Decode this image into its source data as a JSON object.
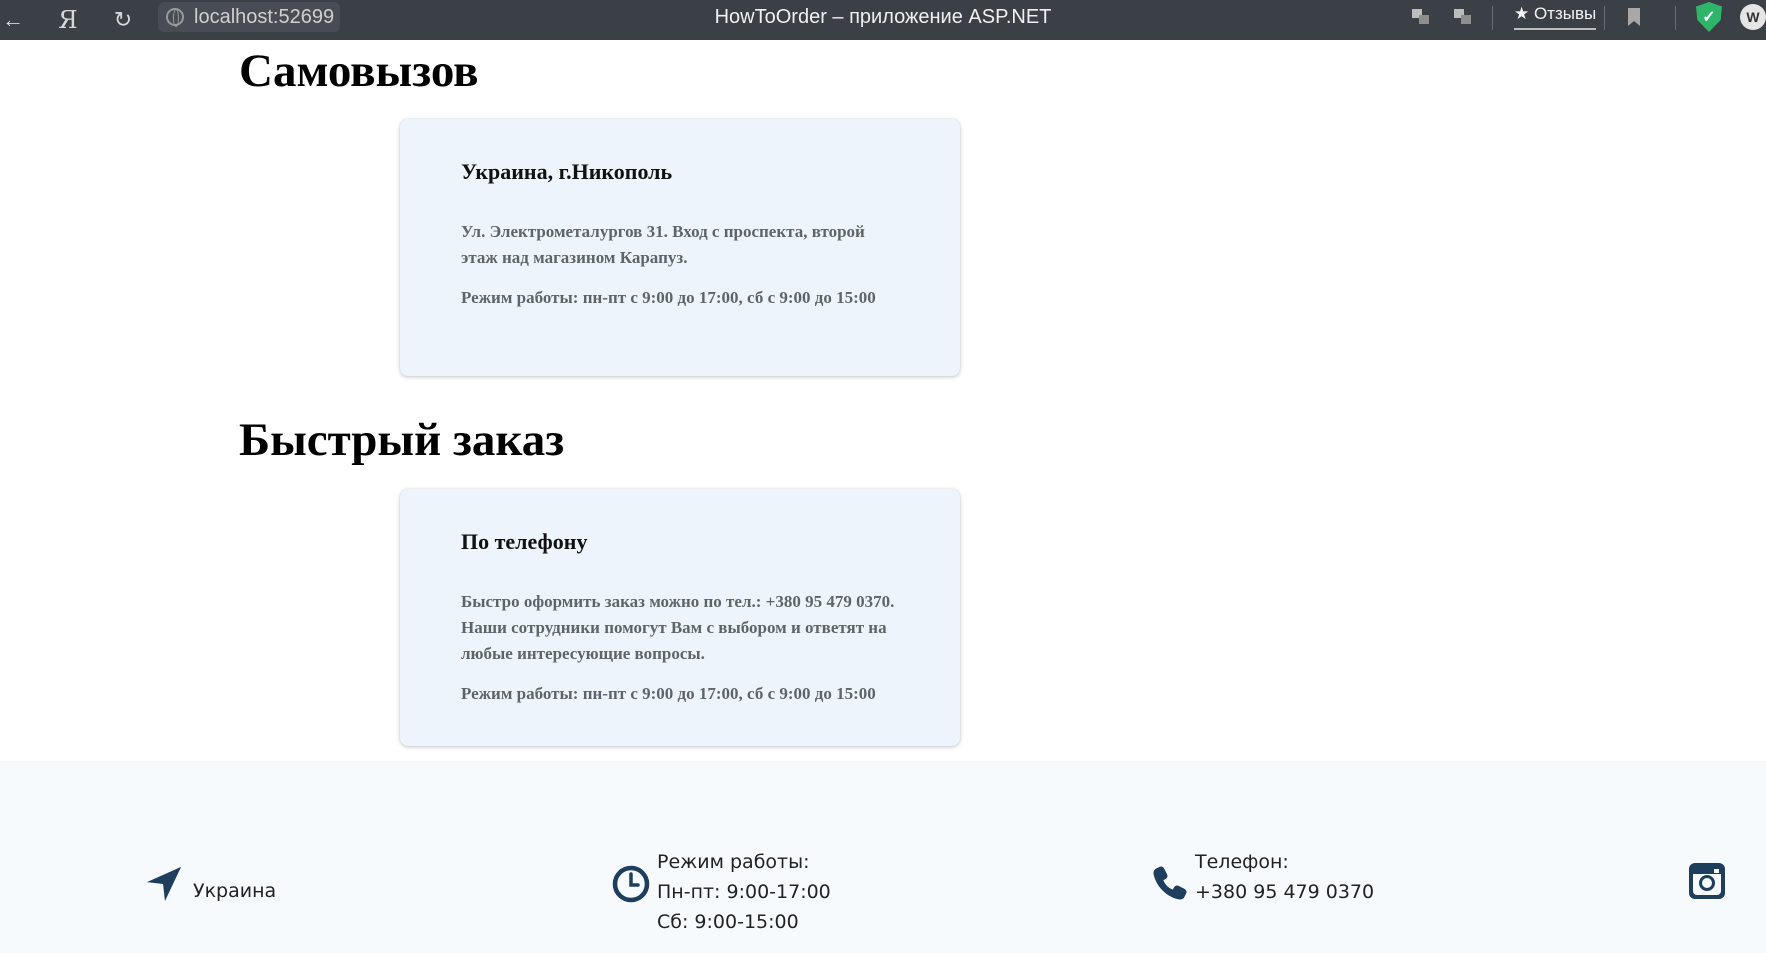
{
  "browser": {
    "address": "localhost:52699",
    "tab_title": "HowToOrder – приложение ASP.NET",
    "reviews_label": "★ Отзывы",
    "yandex_glyph": "Я",
    "avatar_letter": "W"
  },
  "sections": {
    "pickup": {
      "title": "Самовызов",
      "card_heading": "Украина, г.Никополь",
      "address": "Ул. Электрометалургов 31. Вход с проспекта, второй этаж над магазином Карапуз.",
      "hours": "Режим работы: пн-пт с 9:00 до 17:00, сб с 9:00 до 15:00"
    },
    "quick_order": {
      "title": "Быстрый заказ",
      "card_heading": "По телефону",
      "description": "Быстро оформить заказ можно по тел.: +380 95 479 0370. Наши сотрудники помогут Вам с выбором и ответят на любые интересующие вопросы.",
      "hours": "Режим работы: пн-пт с 9:00 до 17:00, сб с 9:00 до 15:00"
    }
  },
  "footer": {
    "location": "Украина",
    "hours_label": "Режим работы:",
    "hours_weekdays": "Пн-пт: 9:00-17:00",
    "hours_saturday": "Сб: 9:00-15:00",
    "phone_label": "Телефон:",
    "phone_number": "+380 95 479 0370"
  },
  "colors": {
    "topbar": "#3b3f46",
    "card_background": "#edf4fb",
    "footer_background": "#f7fafd",
    "icon_navy": "#1f3d5c",
    "shield_green": "#2fb56a"
  }
}
